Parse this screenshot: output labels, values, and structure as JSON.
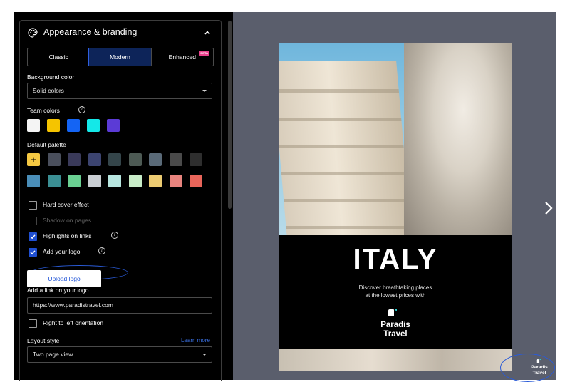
{
  "panel": {
    "section_title": "Appearance & branding",
    "icons": {
      "section": "palette-icon",
      "collapse": "chevron-up-icon"
    },
    "tabs": [
      {
        "label": "Classic",
        "active": false
      },
      {
        "label": "Modern",
        "active": true
      },
      {
        "label": "Enhanced",
        "active": false,
        "badge": "BETA"
      }
    ],
    "background_color": {
      "label": "Background color",
      "value": "Solid colors"
    },
    "team_colors": {
      "label": "Team colors",
      "swatches": [
        "#f4f4f4",
        "#f5c400",
        "#1464f4",
        "#14e8e8",
        "#5b3bd6"
      ]
    },
    "default_palette": {
      "label": "Default palette",
      "add_symbol": "+",
      "row1": [
        "#f5c842",
        "#4a4f5c",
        "#3a3a5a",
        "#3c4470",
        "#34454a",
        "#4d5a54",
        "#5a6a78",
        "#4a4a4a",
        "#2e2e2e"
      ],
      "row2": [
        "#4a8eb8",
        "#3b8f94",
        "#6ad092",
        "#c9ced3",
        "#b7e6e0",
        "#c8ecc8",
        "#eccb72",
        "#e8847e",
        "#e8655a"
      ]
    },
    "options": [
      {
        "label": "Hard cover effect",
        "checked": false,
        "disabled": false
      },
      {
        "label": "Shadow on pages",
        "checked": false,
        "disabled": true
      },
      {
        "label": "Highlights on links",
        "checked": true,
        "disabled": false
      },
      {
        "label": "Add your logo",
        "checked": true,
        "disabled": false
      }
    ],
    "upload_logo_label": "Upload logo",
    "logo_link": {
      "label": "Add a link on your logo",
      "value": "https://www.paradistravel.com"
    },
    "rtl_label": "Right to left orientation",
    "layout_style": {
      "label": "Layout style",
      "learn_more": "Learn more",
      "value": "Two page view"
    }
  },
  "preview": {
    "title": "ITALY",
    "tagline_line1": "Discover breathtaking places",
    "tagline_line2": "at the lowest prices with",
    "brand_line1": "Paradis",
    "brand_line2": "Travel",
    "corner_brand_line1": "Paradis",
    "corner_brand_line2": "Travel",
    "next_icon": "chevron-right-icon",
    "brand_color": "#2ad0d0"
  }
}
